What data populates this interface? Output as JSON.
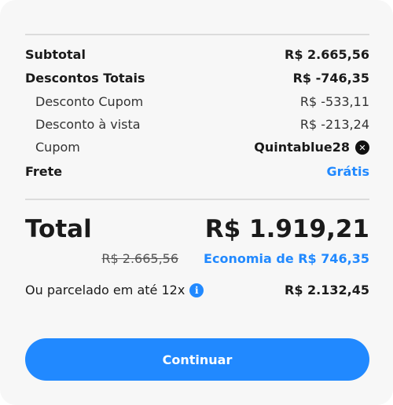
{
  "summary": {
    "subtotal": {
      "label": "Subtotal",
      "value": "R$ 2.665,56"
    },
    "total_discounts": {
      "label": "Descontos Totais",
      "value": "R$ -746,35"
    },
    "coupon_discount": {
      "label": "Desconto Cupom",
      "value": "R$ -533,11"
    },
    "cash_discount": {
      "label": "Desconto à vista",
      "value": "R$ -213,24"
    },
    "coupon": {
      "label": "Cupom",
      "value": "Quintablue28",
      "remove_icon": "close-circle-icon"
    },
    "shipping": {
      "label": "Frete",
      "value": "Grátis"
    }
  },
  "total": {
    "label": "Total",
    "value": "R$ 1.919,21",
    "original_price": "R$ 2.665,56",
    "savings": "Economia de R$ 746,35"
  },
  "installments": {
    "label": "Ou parcelado em até 12x",
    "info_icon": "info-icon",
    "value": "R$ 2.132,45"
  },
  "actions": {
    "continue_label": "Continuar"
  },
  "colors": {
    "accent": "#2189ff",
    "background": "#f7f7f7",
    "text": "#1a1a1a",
    "divider": "#dcdcdc"
  }
}
